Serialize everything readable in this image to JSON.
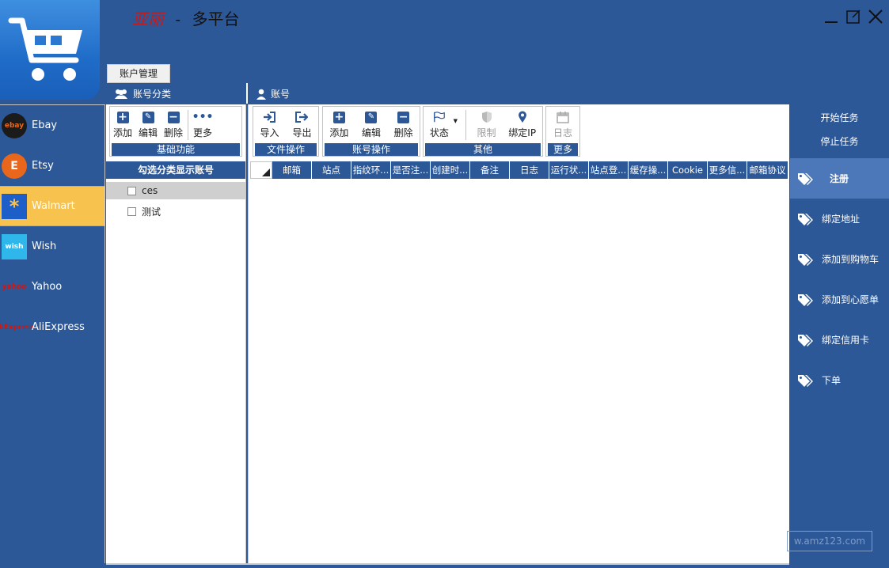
{
  "app": {
    "brand": "亚丽",
    "separator": "-",
    "title": "多平台",
    "tab_label": "账户管理"
  },
  "sections": {
    "category_title": "账号分类",
    "account_title": "账号"
  },
  "platforms": [
    {
      "label": "Ebay",
      "logo_text": "ebay",
      "logo_color": "#1b1b1b"
    },
    {
      "label": "Etsy",
      "logo_text": "E",
      "logo_color": "#e8671c"
    },
    {
      "label": "Walmart",
      "logo_text": "*",
      "logo_color": "#1e5ec8"
    },
    {
      "label": "Wish",
      "logo_text": "wish",
      "logo_color": "#2fb7ec"
    },
    {
      "label": "Yahoo",
      "logo_text": "yahoo",
      "logo_color": "#c81919"
    },
    {
      "label": "AliExpress",
      "logo_text": "AliExpress",
      "logo_color": "#c81919"
    }
  ],
  "active_platform": "Walmart",
  "category_toolbar": {
    "buttons": [
      "添加",
      "编辑",
      "删除",
      "更多"
    ],
    "caption": "基础功能"
  },
  "category_list": {
    "header": "勾选分类显示账号",
    "items": [
      "ces",
      "测试"
    ]
  },
  "account_toolbar": {
    "file_ops": {
      "buttons": [
        "导入",
        "导出"
      ],
      "caption": "文件操作"
    },
    "account_ops": {
      "buttons": [
        "添加",
        "编辑",
        "删除"
      ],
      "caption": "账号操作"
    },
    "other": {
      "buttons": [
        "状态",
        "限制",
        "绑定IP"
      ],
      "caption": "其他"
    },
    "more": {
      "buttons": [
        "日志"
      ],
      "caption": "更多"
    }
  },
  "grid_columns": [
    "邮箱",
    "站点",
    "指纹环...",
    "是否注...",
    "创建时...",
    "备注",
    "日志",
    "运行状...",
    "站点登...",
    "缓存操...",
    "Cookie",
    "更多信...",
    "邮箱协议"
  ],
  "tasks": {
    "start": "开始任务",
    "stop": "停止任务",
    "items": [
      "注册",
      "绑定地址",
      "添加到购物车",
      "添加到心愿单",
      "绑定信用卡",
      "下单"
    ]
  },
  "watermark": "w.amz123.com",
  "colors": {
    "primary": "#2d5898",
    "active_platform": "#f7c24d",
    "active_task": "#4c77b8"
  }
}
